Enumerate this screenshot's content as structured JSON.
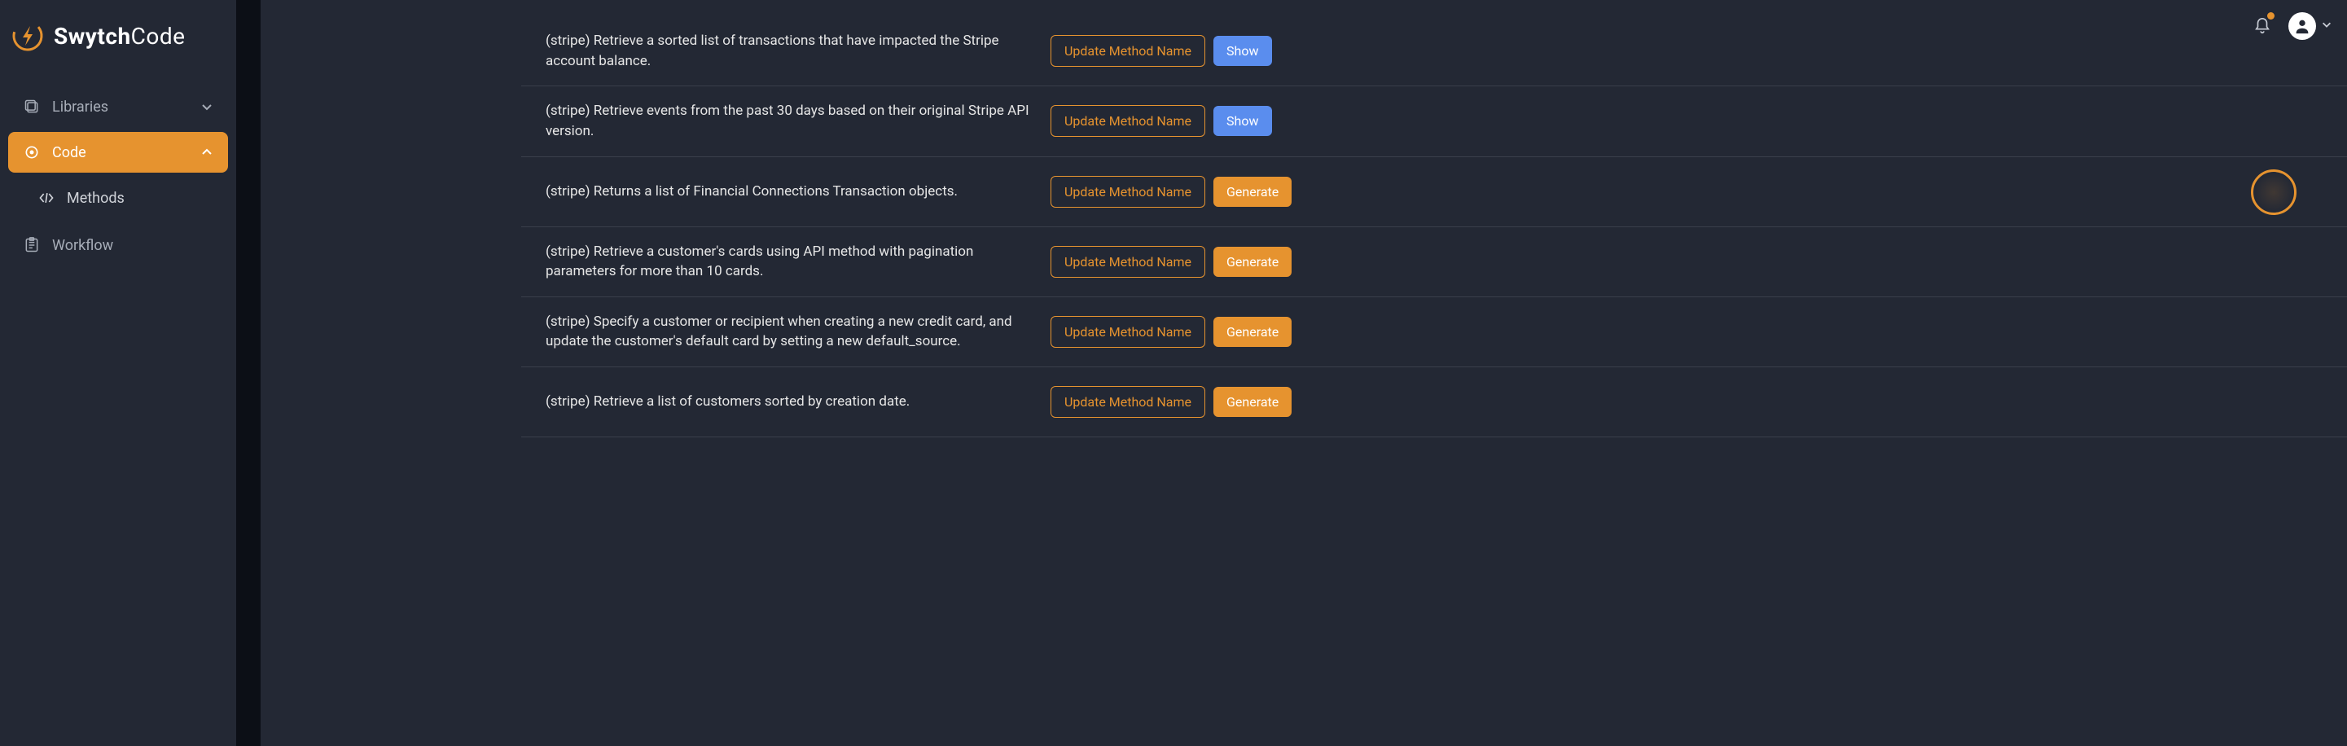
{
  "brand": {
    "bold": "Swytch",
    "light": "Code"
  },
  "nav": {
    "libraries": "Libraries",
    "code": "Code",
    "methods": "Methods",
    "workflow": "Workflow"
  },
  "buttons": {
    "update": "Update Method Name",
    "show": "Show",
    "generate": "Generate"
  },
  "methods": [
    {
      "desc": "(stripe) Retrieve a sorted list of transactions that have impacted the Stripe account balance.",
      "action": "show"
    },
    {
      "desc": "(stripe) Retrieve events from the past 30 days based on their original Stripe API version.",
      "action": "show"
    },
    {
      "desc": "(stripe) Returns a list of Financial Connections Transaction objects.",
      "action": "generate"
    },
    {
      "desc": "(stripe) Retrieve a customer's cards using API method with pagination parameters for more than 10 cards.",
      "action": "generate"
    },
    {
      "desc": "(stripe) Specify a customer or recipient when creating a new credit card, and update the customer's default card by setting a new default_source.",
      "action": "generate"
    },
    {
      "desc": "(stripe) Retrieve a list of customers sorted by creation date.",
      "action": "generate"
    }
  ],
  "colors": {
    "accent": "#e6932f",
    "blue": "#5a8dee",
    "bg": "#232834"
  }
}
